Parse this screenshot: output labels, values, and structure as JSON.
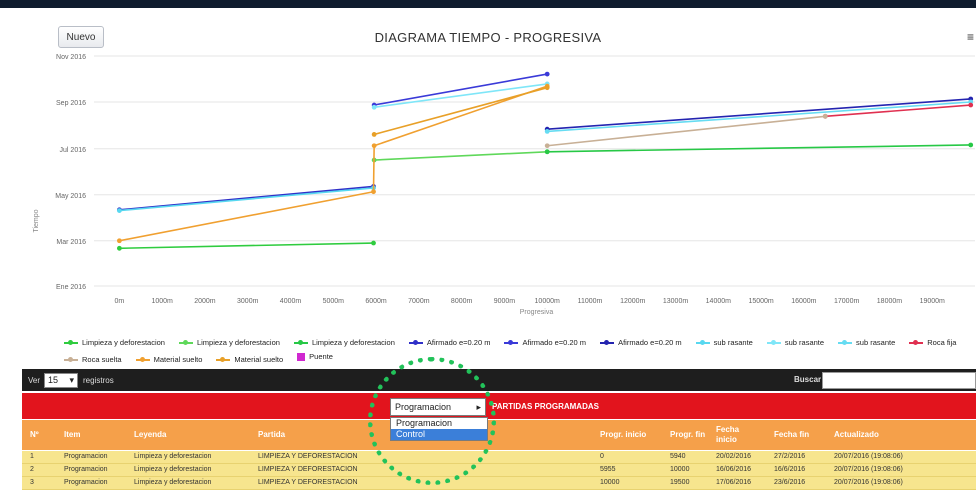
{
  "toolbar": {
    "new_label": "Nuevo",
    "menu_icon": "menu-icon"
  },
  "chart_data": {
    "type": "line",
    "title": "DIAGRAMA TIEMPO - PROGRESIVA",
    "xlabel": "Progresiva",
    "ylabel": "Tiempo",
    "xlim": [
      -500,
      20000
    ],
    "x_tick_labels": [
      "0m",
      "1000m",
      "2000m",
      "3000m",
      "4000m",
      "5000m",
      "6000m",
      "7000m",
      "8000m",
      "9000m",
      "10000m",
      "11000m",
      "12000m",
      "13000m",
      "14000m",
      "15000m",
      "16000m",
      "17000m",
      "18000m",
      "19000m"
    ],
    "y_tick_labels": [
      "Nov 2016",
      "Sep 2016",
      "Jul 2016",
      "May 2016",
      "Mar 2016",
      "Ene 2016"
    ],
    "ylim": [
      "Ene 2016",
      "Nov 2016"
    ],
    "legend_position": "bottom",
    "series": [
      {
        "name": "Limpieza y deforestacion",
        "color": "#2fcc3f",
        "points": [
          [
            0,
            "2016-02-20"
          ],
          [
            5940,
            "2016-02-27"
          ]
        ]
      },
      {
        "name": "Limpieza y deforestacion",
        "color": "#5fd85a",
        "points": [
          [
            5955,
            "2016-06-16"
          ],
          [
            10000,
            "2016-06-27"
          ]
        ]
      },
      {
        "name": "Limpieza y deforestacion",
        "color": "#27c846",
        "points": [
          [
            10000,
            "2016-06-27"
          ],
          [
            19900,
            "2016-07-06"
          ]
        ]
      },
      {
        "name": "Afirmado e=0.20 m",
        "color": "#3030c8",
        "points": [
          [
            0,
            "2016-04-11"
          ],
          [
            5940,
            "2016-05-12"
          ]
        ]
      },
      {
        "name": "Afirmado e=0.20 m",
        "color": "#3a3ad8",
        "points": [
          [
            5955,
            "2016-08-28"
          ],
          [
            10000,
            "2016-10-08"
          ]
        ]
      },
      {
        "name": "Afirmado e=0.20 m",
        "color": "#2424b0",
        "points": [
          [
            10000,
            "2016-07-27"
          ],
          [
            19900,
            "2016-09-05"
          ]
        ]
      },
      {
        "name": "sub rasante",
        "color": "#58d8f0",
        "points": [
          [
            0,
            "2016-04-10"
          ],
          [
            5940,
            "2016-05-10"
          ]
        ]
      },
      {
        "name": "sub rasante",
        "color": "#7fe6f8",
        "points": [
          [
            5955,
            "2016-08-25"
          ],
          [
            10000,
            "2016-09-25"
          ]
        ]
      },
      {
        "name": "sub rasante",
        "color": "#66dcf2",
        "points": [
          [
            10000,
            "2016-07-24"
          ],
          [
            19900,
            "2016-09-01"
          ]
        ]
      },
      {
        "name": "Roca fija",
        "color": "#e03050",
        "points": [
          [
            16500,
            "2016-08-13"
          ],
          [
            19900,
            "2016-08-28"
          ]
        ]
      },
      {
        "name": "Roca suelta",
        "color": "#c8b096",
        "points": [
          [
            10000,
            "2016-07-05"
          ],
          [
            16500,
            "2016-08-13"
          ]
        ]
      },
      {
        "name": "Material suelto",
        "color": "#f0a030",
        "points": [
          [
            0,
            "2016-03-01"
          ],
          [
            5940,
            "2016-05-05"
          ],
          [
            5955,
            "2016-07-05"
          ],
          [
            10000,
            "2016-09-22"
          ]
        ]
      },
      {
        "name": "Material suelto",
        "color": "#e8a028",
        "points": [
          [
            5955,
            "2016-07-20"
          ],
          [
            10000,
            "2016-09-20"
          ]
        ]
      },
      {
        "name": "Puente",
        "color": "#d028d0",
        "points": []
      }
    ]
  },
  "legend": [
    {
      "label": "Limpieza y deforestacion",
      "color": "#2fcc3f",
      "shape": "line"
    },
    {
      "label": "Limpieza y deforestacion",
      "color": "#5fd85a",
      "shape": "line"
    },
    {
      "label": "Limpieza y deforestacion",
      "color": "#27c846",
      "shape": "line"
    },
    {
      "label": "Afirmado e=0.20 m",
      "color": "#3030c8",
      "shape": "line"
    },
    {
      "label": "Afirmado e=0.20 m",
      "color": "#3a3ad8",
      "shape": "line"
    },
    {
      "label": "Afirmado e=0.20 m",
      "color": "#2424b0",
      "shape": "line"
    },
    {
      "label": "sub rasante",
      "color": "#58d8f0",
      "shape": "line"
    },
    {
      "label": "sub rasante",
      "color": "#7fe6f8",
      "shape": "line"
    },
    {
      "label": "sub rasante",
      "color": "#66dcf2",
      "shape": "line"
    },
    {
      "label": "Roca fija",
      "color": "#e03050",
      "shape": "line"
    },
    {
      "label": "Roca suelta",
      "color": "#c8b096",
      "shape": "line"
    },
    {
      "label": "Material suelto",
      "color": "#f0a030",
      "shape": "line"
    },
    {
      "label": "Material suelto",
      "color": "#e8a028",
      "shape": "line"
    },
    {
      "label": "Puente",
      "color": "#d028d0",
      "shape": "box"
    }
  ],
  "table_controls": {
    "show_label": "Ver",
    "page_size": "15",
    "records_label": "registros",
    "search_label": "Buscar :",
    "search_value": ""
  },
  "filter": {
    "selected": "Programacion",
    "title": "PARTIDAS PROGRAMADAS",
    "options": [
      "Programacion",
      "Control"
    ],
    "highlighted": "Control"
  },
  "table": {
    "headers": [
      "Nº",
      "Item",
      "Leyenda",
      "Partida",
      "Progr. inicio",
      "Progr. fin",
      "Fecha inicio",
      "Fecha fin",
      "Actualizado"
    ],
    "rows": [
      [
        "1",
        "Programacion",
        "Limpieza y deforestacion",
        "LIMPIEZA Y DEFORESTACION",
        "0",
        "5940",
        "20/02/2016",
        "27/2/2016",
        "20/07/2016 (19:08:06)"
      ],
      [
        "2",
        "Programacion",
        "Limpieza y deforestacion",
        "LIMPIEZA Y DEFORESTACION",
        "5955",
        "10000",
        "16/06/2016",
        "16/6/2016",
        "20/07/2016 (19:08:06)"
      ],
      [
        "3",
        "Programacion",
        "Limpieza y deforestacion",
        "LIMPIEZA Y DEFORESTACION",
        "10000",
        "19500",
        "17/06/2016",
        "23/6/2016",
        "20/07/2016 (19:08:06)"
      ]
    ]
  }
}
